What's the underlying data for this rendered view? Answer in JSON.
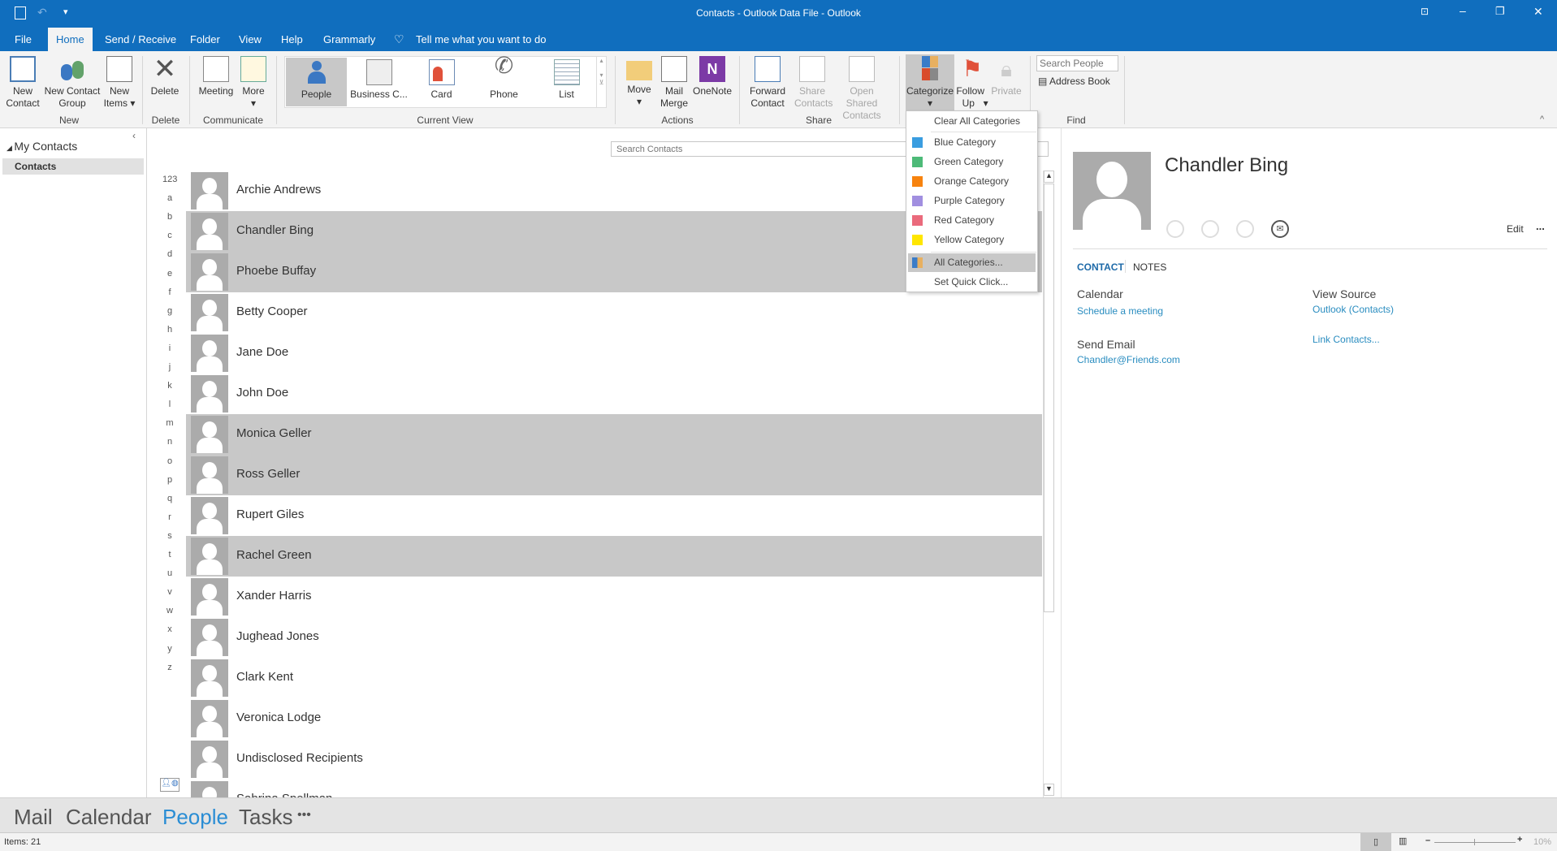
{
  "window": {
    "title": "Contacts - Outlook Data File  -  Outlook"
  },
  "tabs": [
    {
      "label": "File"
    },
    {
      "label": "Home"
    },
    {
      "label": "Send / Receive"
    },
    {
      "label": "Folder"
    },
    {
      "label": "View"
    },
    {
      "label": "Help"
    },
    {
      "label": "Grammarly"
    }
  ],
  "tell_me": "Tell me what you want to do",
  "ribbon": {
    "new_contact": "New Contact",
    "new_group": "New Contact Group",
    "new_items": "New Items",
    "delete": "Delete",
    "meeting": "Meeting",
    "more": "More",
    "views": [
      "People",
      "Business C...",
      "Card",
      "Phone",
      "List"
    ],
    "move": "Move",
    "mail_merge": "Mail Merge",
    "onenote": "OneNote",
    "forward_contact": "Forward Contact",
    "share_contacts": "Share Contacts",
    "open_shared": "Open Shared Contacts",
    "categorize": "Categorize",
    "follow_up": "Follow Up",
    "private": "Private",
    "search_people_placeholder": "Search People",
    "address_book": "Address Book",
    "groups": {
      "new": "New",
      "delete": "Delete",
      "communicate": "Communicate",
      "current_view": "Current View",
      "actions": "Actions",
      "share": "Share",
      "find": "Find"
    }
  },
  "categorize_menu": {
    "clear": "Clear All Categories",
    "items": [
      {
        "label": "Blue Category",
        "color": "#3a9de0"
      },
      {
        "label": "Green Category",
        "color": "#4dba78"
      },
      {
        "label": "Orange Category",
        "color": "#f7830e"
      },
      {
        "label": "Purple Category",
        "color": "#a18fe0"
      },
      {
        "label": "Red Category",
        "color": "#ea6a7c"
      },
      {
        "label": "Yellow Category",
        "color": "#ffe600"
      }
    ],
    "all": "All Categories...",
    "quick": "Set Quick Click..."
  },
  "navpane": {
    "group": "My Contacts",
    "folder": "Contacts"
  },
  "search_contacts_placeholder": "Search Contacts",
  "alphabet": [
    "123",
    "a",
    "b",
    "c",
    "d",
    "e",
    "f",
    "g",
    "h",
    "i",
    "j",
    "k",
    "l",
    "m",
    "n",
    "o",
    "p",
    "q",
    "r",
    "s",
    "t",
    "u",
    "v",
    "w",
    "x",
    "y",
    "z"
  ],
  "contacts": [
    {
      "name": "Archie Andrews",
      "selected": false
    },
    {
      "name": "Chandler Bing",
      "selected": true
    },
    {
      "name": "Phoebe Buffay",
      "selected": true
    },
    {
      "name": "Betty Cooper",
      "selected": false
    },
    {
      "name": "Jane Doe",
      "selected": false
    },
    {
      "name": "John Doe",
      "selected": false
    },
    {
      "name": "Monica Geller",
      "selected": true
    },
    {
      "name": "Ross Geller",
      "selected": true
    },
    {
      "name": "Rupert Giles",
      "selected": false
    },
    {
      "name": "Rachel Green",
      "selected": true
    },
    {
      "name": "Xander Harris",
      "selected": false
    },
    {
      "name": "Jughead Jones",
      "selected": false
    },
    {
      "name": "Clark Kent",
      "selected": false
    },
    {
      "name": "Veronica Lodge",
      "selected": false
    },
    {
      "name": "Undisclosed Recipients",
      "selected": false
    },
    {
      "name": "Sabrina Spellman",
      "selected": false
    }
  ],
  "reading": {
    "name": "Chandler Bing",
    "edit": "Edit",
    "more": "...",
    "tab_contact": "CONTACT",
    "tab_notes": "NOTES",
    "calendar_label": "Calendar",
    "calendar_link": "Schedule a meeting",
    "email_label": "Send Email",
    "email": "Chandler@Friends.com",
    "source_label": "View Source",
    "source_link": "Outlook (Contacts)",
    "link_contacts": "Link Contacts..."
  },
  "bottomnav": {
    "mail": "Mail",
    "calendar": "Calendar",
    "people": "People",
    "tasks": "Tasks",
    "more": "•••"
  },
  "status": {
    "items": "Items: 21",
    "zoom": "10%"
  }
}
